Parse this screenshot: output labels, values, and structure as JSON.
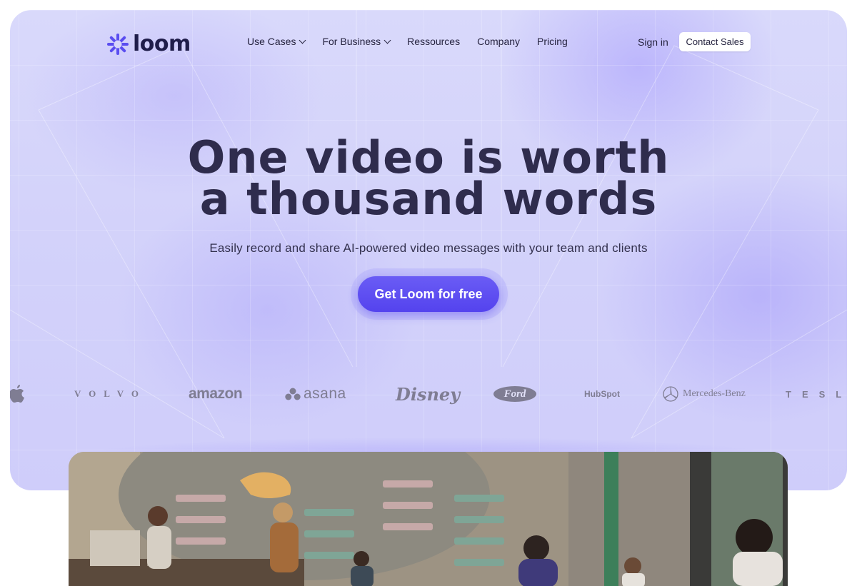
{
  "nav": {
    "logo_text": "loom",
    "items": [
      {
        "label": "Use Cases",
        "dropdown": true
      },
      {
        "label": "For Business",
        "dropdown": true
      },
      {
        "label": "Ressources",
        "dropdown": false
      },
      {
        "label": "Company",
        "dropdown": false
      },
      {
        "label": "Pricing",
        "dropdown": false
      }
    ],
    "sign_in": "Sign in",
    "contact_sales": "Contact Sales"
  },
  "hero": {
    "headline_line1": "One video is worth",
    "headline_line2": "a thousand words",
    "subheadline": "Easily record and share AI-powered video messages with your team and clients",
    "cta": "Get Loom for free"
  },
  "logos": {
    "volvo": "VOLVO",
    "amazon": "amazon",
    "asana": "asana",
    "disney": "Disney",
    "ford": "Ford",
    "hubspot": "HubSpot",
    "mercedes": "Mercedes-Benz",
    "tesla": "TESL"
  },
  "colors": {
    "accent": "#5443ee",
    "hero_bg": "#d3d2fa",
    "text": "#2f2c4d"
  },
  "media": {
    "photo_alt_icon": "cafe-scene-photo"
  }
}
